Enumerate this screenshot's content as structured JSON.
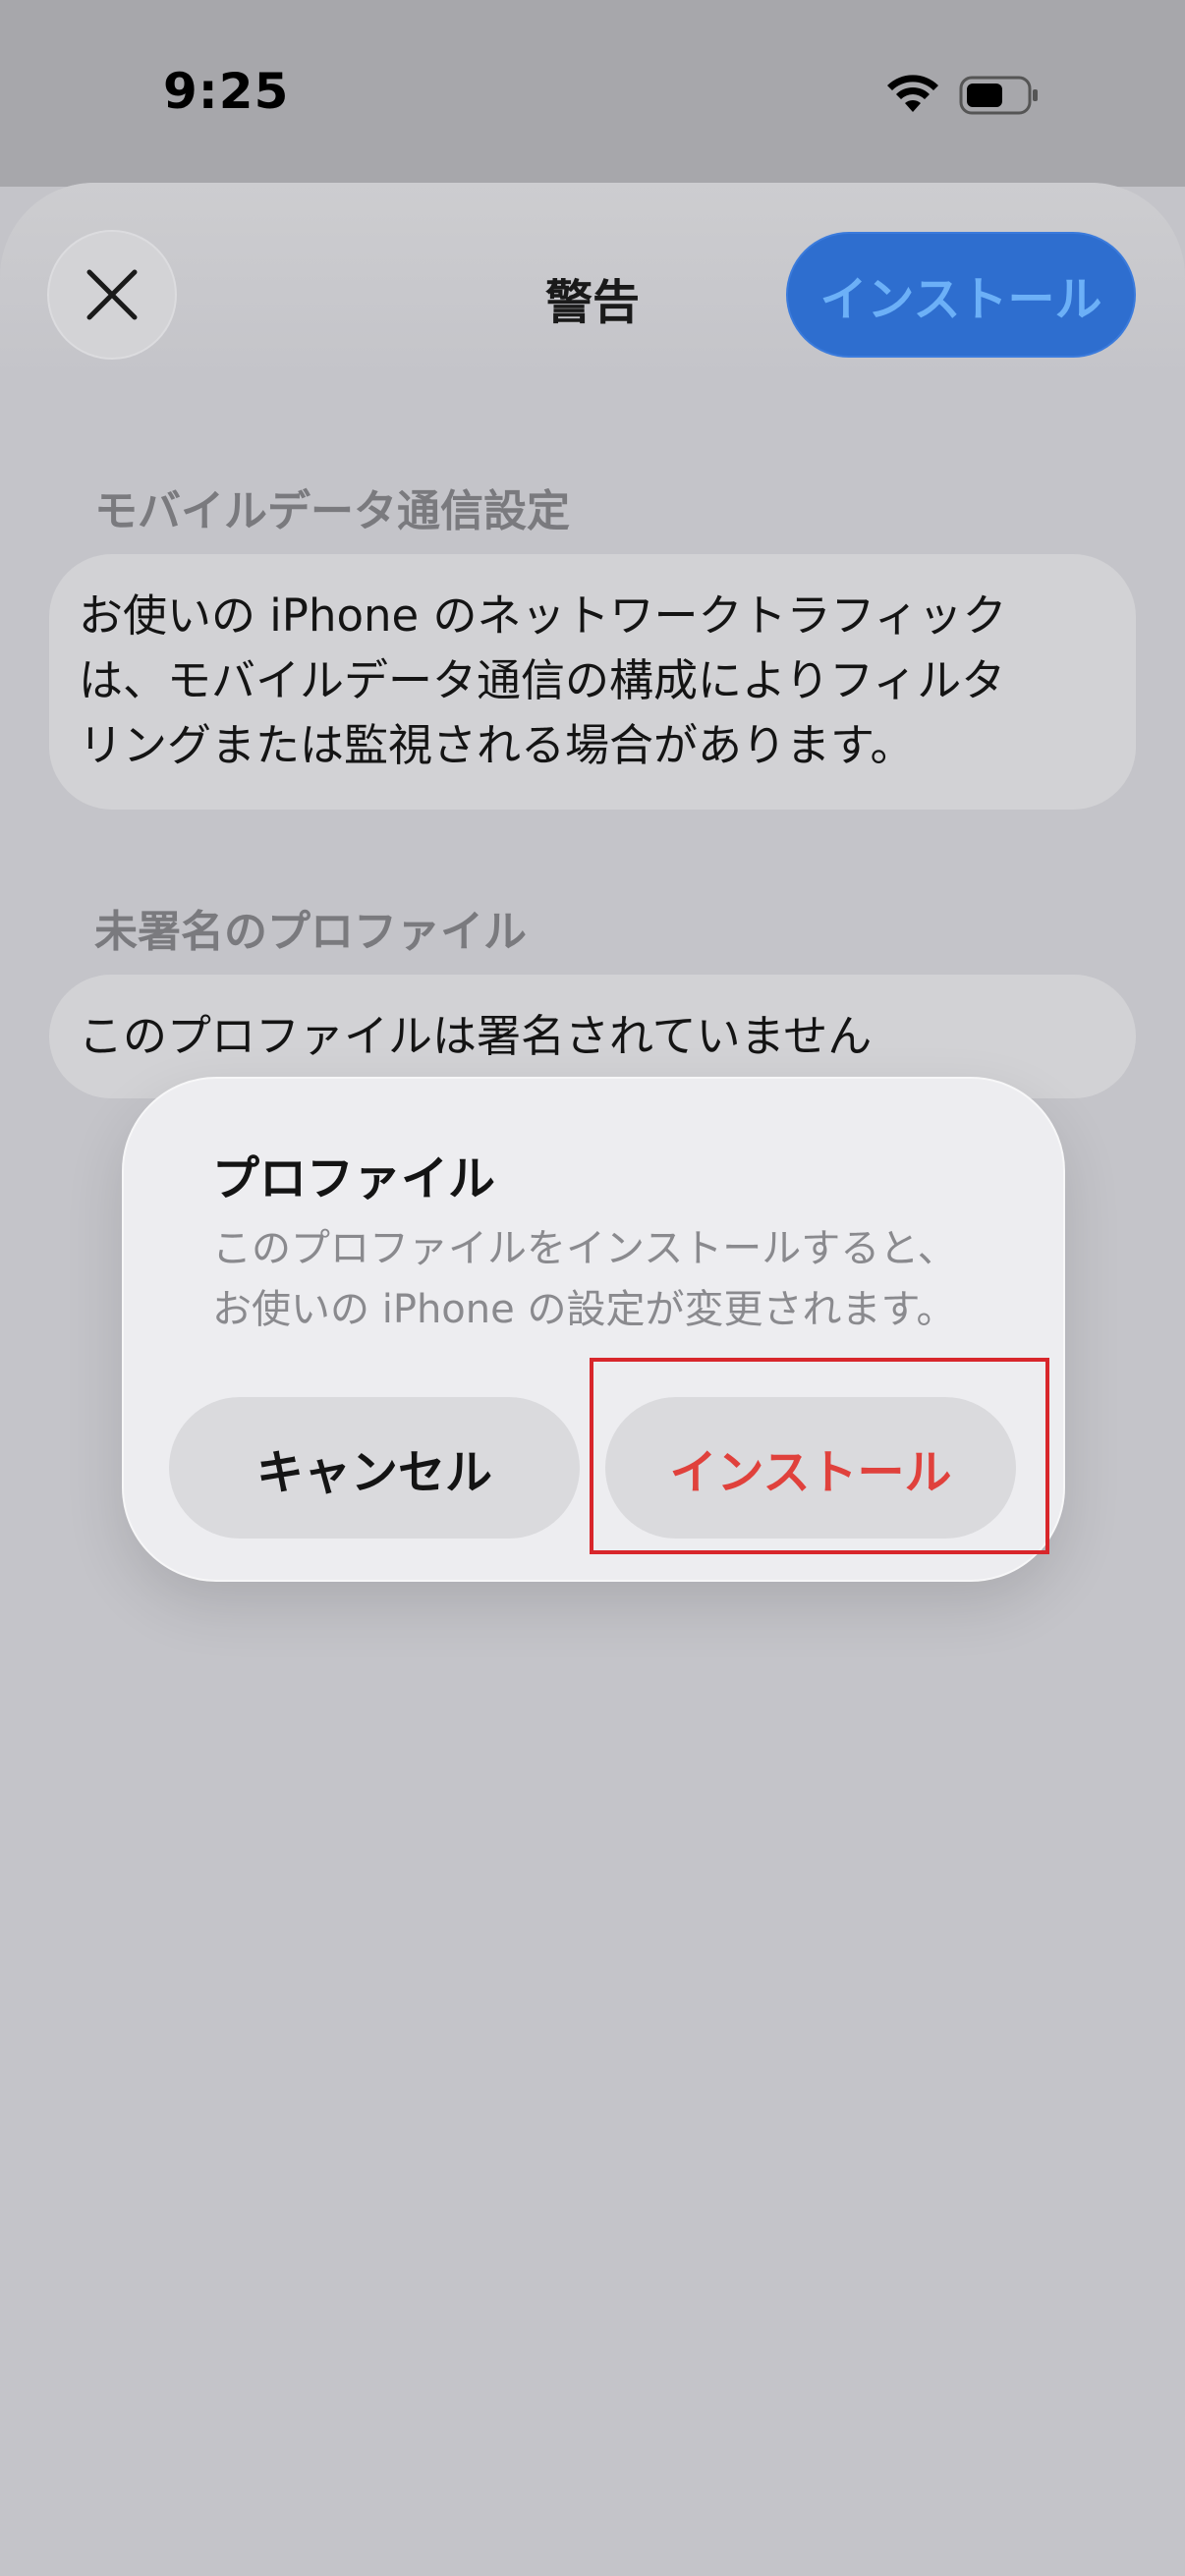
{
  "status_bar": {
    "time": "9:25",
    "icons": [
      "wifi-icon",
      "battery-icon"
    ]
  },
  "header": {
    "title": "警告",
    "install_label": "インストール",
    "close_icon": "close-icon"
  },
  "sections": [
    {
      "header": "モバイルデータ通信設定",
      "body_lines": [
        "お使いの iPhone のネットワークトラフィック",
        "は、モバイルデータ通信の構成によりフィルタ",
        "リングまたは監視される場合があります。"
      ]
    },
    {
      "header": "未署名のプロファイル",
      "body_lines": [
        "このプロファイルは署名されていません"
      ]
    }
  ],
  "alert": {
    "title": "プロファイル",
    "message_lines": [
      "このプロファイルをインストールすると、",
      "お使いの iPhone の設定が変更されます。"
    ],
    "cancel_label": "キャンセル",
    "install_label": "インストール"
  },
  "colors": {
    "accent_blue": "#2e6ecf",
    "destructive_red": "#e0413c",
    "highlight_red": "#d8262b"
  }
}
